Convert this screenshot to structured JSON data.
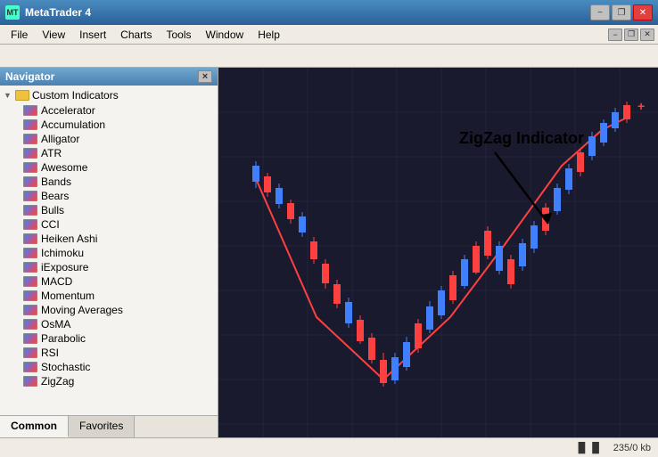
{
  "titleBar": {
    "title": "MetaTrader 4",
    "minimizeLabel": "−",
    "restoreLabel": "❐",
    "closeLabel": "✕"
  },
  "menuBar": {
    "items": [
      "File",
      "View",
      "Insert",
      "Charts",
      "Tools",
      "Window",
      "Help"
    ]
  },
  "navigator": {
    "title": "Navigator",
    "closeLabel": "×",
    "sections": {
      "customIndicators": {
        "label": "Custom Indicators",
        "expanded": true,
        "items": [
          "Accelerator",
          "Accumulation",
          "Alligator",
          "ATR",
          "Awesome",
          "Bands",
          "Bears",
          "Bulls",
          "CCI",
          "Heiken Ashi",
          "Ichimoku",
          "iExposure",
          "MACD",
          "Momentum",
          "Moving Averages",
          "OsMA",
          "Parabolic",
          "RSI",
          "Stochastic",
          "ZigZag"
        ]
      }
    }
  },
  "navTabs": {
    "tabs": [
      "Common",
      "Favorites"
    ],
    "activeTab": "Common"
  },
  "chart": {
    "annotation": "ZigZag Indicator"
  },
  "statusBar": {
    "indicator": "▐▌▐▌",
    "memory": "235/0 kb"
  }
}
